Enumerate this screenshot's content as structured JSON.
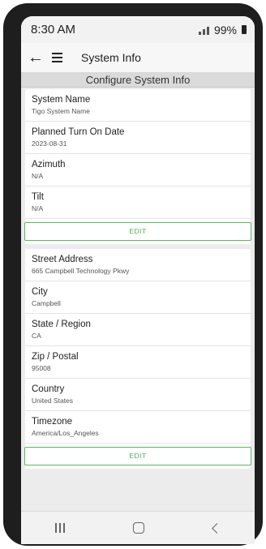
{
  "status_bar": {
    "time": "8:30 AM",
    "battery": "99%"
  },
  "app_bar": {
    "title": "System Info",
    "back_icon": "arrow-left-icon",
    "menu_icon": "hamburger-menu-icon"
  },
  "sub_header": "Configure System Info",
  "system_card": {
    "fields": [
      {
        "label": "System Name",
        "value": "Tigo System Name"
      },
      {
        "label": "Planned Turn On Date",
        "value": "2023-08-31"
      },
      {
        "label": "Azimuth",
        "value": "N/A"
      },
      {
        "label": "Tilt",
        "value": "N/A"
      }
    ],
    "edit_label": "EDIT"
  },
  "address_card": {
    "fields": [
      {
        "label": "Street Address",
        "value": "665 Campbell Technology Pkwy"
      },
      {
        "label": "City",
        "value": "Campbell"
      },
      {
        "label": "State / Region",
        "value": "CA"
      },
      {
        "label": "Zip / Postal",
        "value": "95008"
      },
      {
        "label": "Country",
        "value": "United States"
      },
      {
        "label": "Timezone",
        "value": "America/Los_Angeles"
      }
    ],
    "edit_label": "EDIT"
  },
  "nav_bar": {
    "recent_icon": "recent-apps-icon",
    "home_icon": "home-icon",
    "back_icon": "back-chevron-icon"
  },
  "colors": {
    "accent": "#4caf50",
    "background": "#ececec"
  }
}
